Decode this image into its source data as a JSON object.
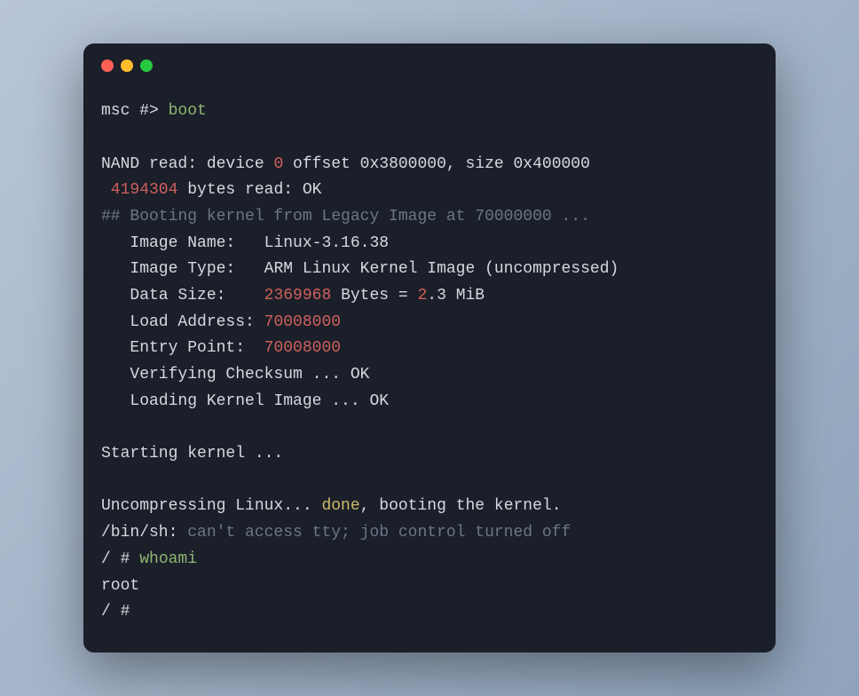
{
  "prompt1_prefix": "msc #> ",
  "prompt1_command": "boot",
  "nand_read_prefix": "NAND read: device ",
  "nand_device": "0",
  "nand_read_suffix": " offset 0x3800000, size 0x400000",
  "bytes_read_num": " 4194304",
  "bytes_read_suffix": " bytes read: OK",
  "booting_header": "## Booting kernel from Legacy Image at 70000000 ...",
  "image_name_label": "   Image Name:   ",
  "image_name_value": "Linux-3.16.38",
  "image_type_label": "   Image Type:   ",
  "image_type_value": "ARM Linux Kernel Image (uncompressed)",
  "data_size_label": "   Data Size:    ",
  "data_size_num1": "2369968",
  "data_size_mid": " Bytes = ",
  "data_size_num2": "2",
  "data_size_suffix": ".3 MiB",
  "load_address_label": "   Load Address: ",
  "load_address_value": "70008000",
  "entry_point_label": "   Entry Point:  ",
  "entry_point_value": "70008000",
  "verifying": "   Verifying Checksum ... OK",
  "loading": "   Loading Kernel Image ... OK",
  "starting_kernel": "Starting kernel ...",
  "uncompressing_prefix": "Uncompressing Linux... ",
  "uncompressing_done": "done",
  "uncompressing_suffix": ", booting the kernel.",
  "sh_prefix": "/bin/sh: ",
  "sh_message": "can't access tty; job control turned off",
  "prompt2_prefix": "/ # ",
  "prompt2_command": "whoami",
  "whoami_output": "root",
  "prompt3": "/ # "
}
